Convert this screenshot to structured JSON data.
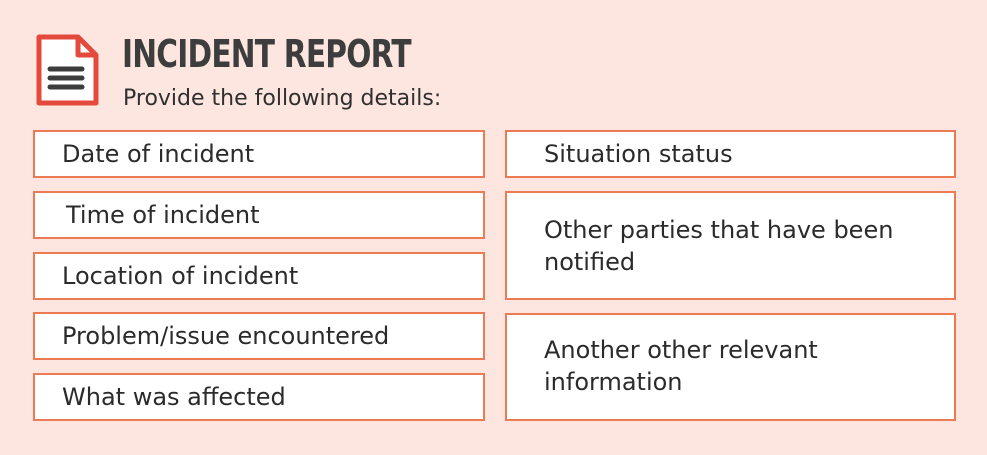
{
  "header": {
    "title": "INCIDENT REPORT",
    "subtitle": "Provide the following details:",
    "icon": "document-icon"
  },
  "left_fields": [
    "Date of incident",
    "Time of incident",
    "Location of incident",
    "Problem/issue encountered",
    "What was affected"
  ],
  "right_fields": [
    "Situation status",
    "Other parties that have been notified",
    "Another other relevant information"
  ],
  "colors": {
    "background": "#fde6e0",
    "accent": "#ec7a52",
    "icon_red": "#e34a3b",
    "text": "#2b2b2b"
  }
}
